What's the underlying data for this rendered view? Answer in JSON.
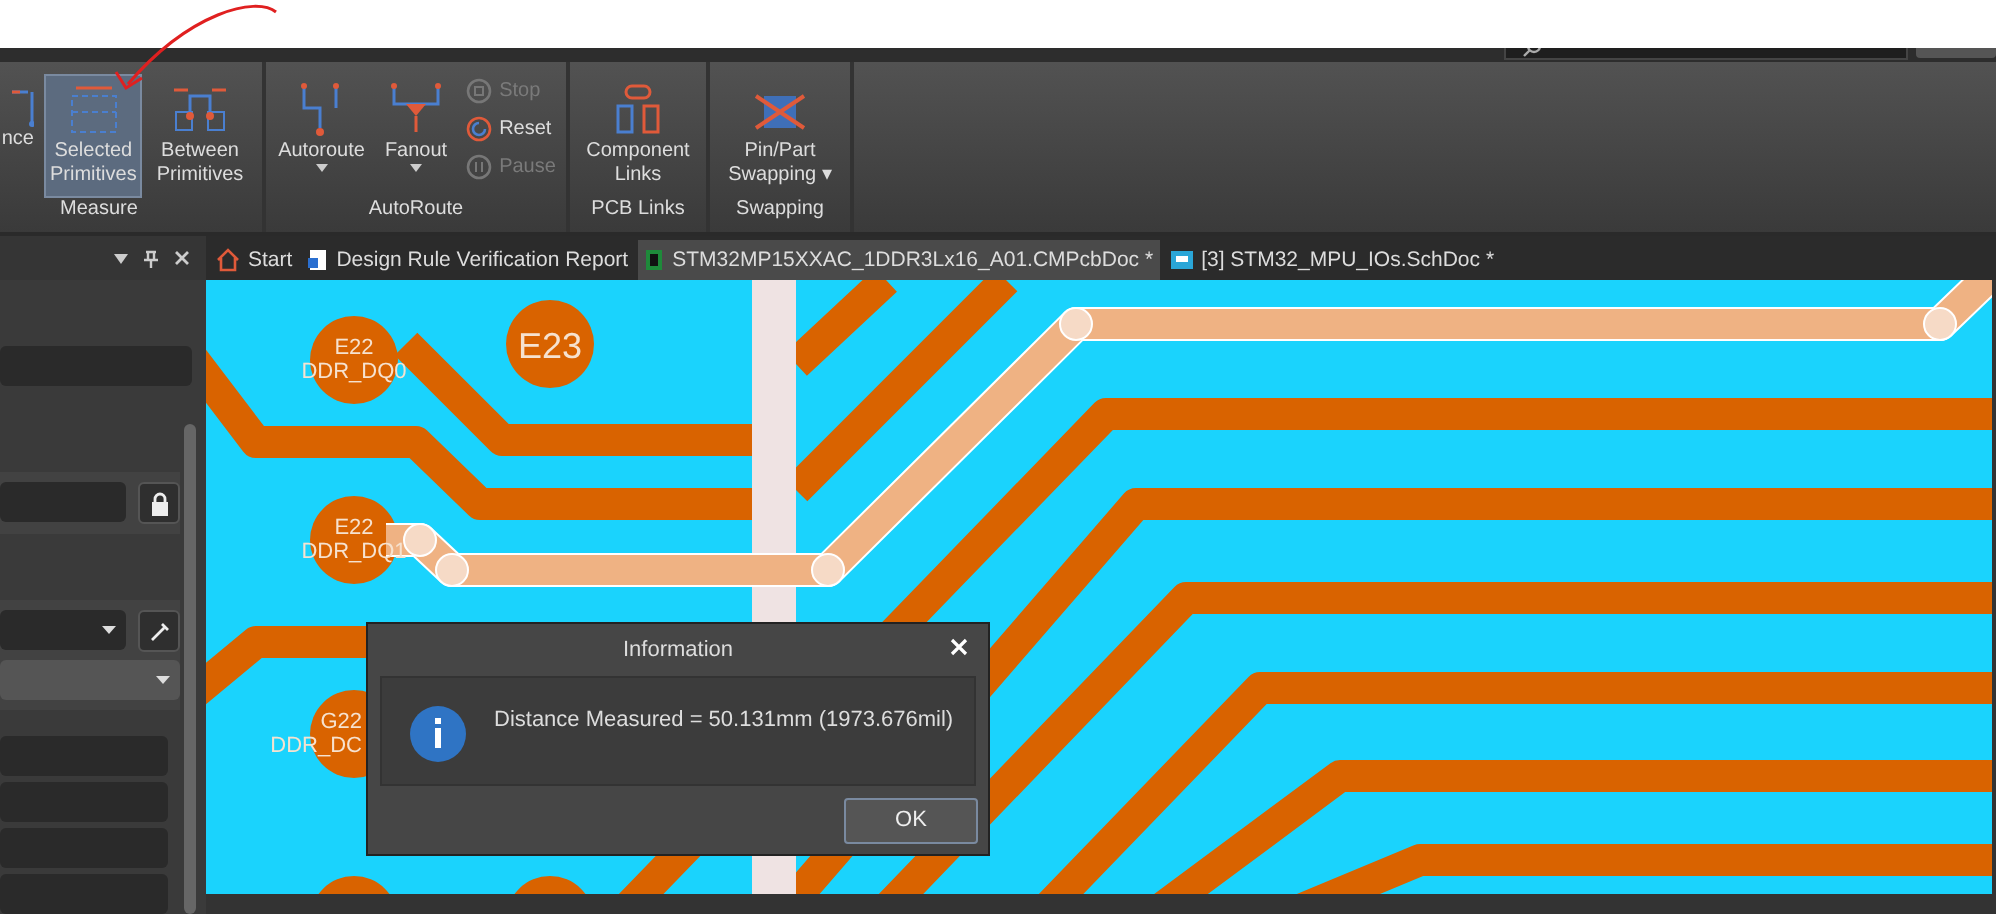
{
  "ribbon": {
    "groups": [
      {
        "label": "Measure",
        "buttons": [
          {
            "lines": [
              "nce"
            ],
            "selected": false,
            "dropdown": false
          },
          {
            "lines": [
              "Selected",
              "Primitives"
            ],
            "selected": true,
            "dropdown": false
          },
          {
            "lines": [
              "Between",
              "Primitives"
            ],
            "selected": false,
            "dropdown": false
          }
        ]
      },
      {
        "label": "AutoRoute",
        "buttons": [
          {
            "lines": [
              "Autoroute"
            ],
            "selected": false,
            "dropdown": true
          },
          {
            "lines": [
              "Fanout"
            ],
            "selected": false,
            "dropdown": true
          }
        ],
        "small_buttons": [
          {
            "label": "Stop",
            "disabled": true
          },
          {
            "label": "Reset",
            "disabled": false
          },
          {
            "label": "Pause",
            "disabled": true
          }
        ]
      },
      {
        "label": "PCB Links",
        "buttons": [
          {
            "lines": [
              "Component",
              "Links"
            ],
            "selected": false,
            "dropdown": false
          }
        ]
      },
      {
        "label": "Swapping",
        "buttons": [
          {
            "lines": [
              "Pin/Part",
              "Swapping ▾"
            ],
            "selected": false,
            "dropdown": false
          }
        ]
      }
    ]
  },
  "tabs": [
    {
      "label": "Start",
      "kind": "home",
      "selected": false
    },
    {
      "label": "Design Rule Verification Report",
      "kind": "report",
      "selected": false
    },
    {
      "label": "STM32MP15XXAC_1DDR3Lx16_A01.CMPcbDoc *",
      "kind": "pcb",
      "selected": true
    },
    {
      "label": "[3] STM32_MPU_IOs.SchDoc *",
      "kind": "schematic",
      "selected": false
    }
  ],
  "pads": [
    {
      "lines": [
        "E22",
        "DDR_DQ0"
      ]
    },
    {
      "lines": [
        "E23"
      ]
    },
    {
      "lines": [
        "E22",
        "DDR_DQ1"
      ]
    },
    {
      "lines": [
        "G22",
        "DDR_DC"
      ]
    }
  ],
  "dialog": {
    "title": "Information",
    "message": "Distance Measured = 50.131mm (1973.676mil)",
    "buttons": [
      "OK"
    ]
  }
}
